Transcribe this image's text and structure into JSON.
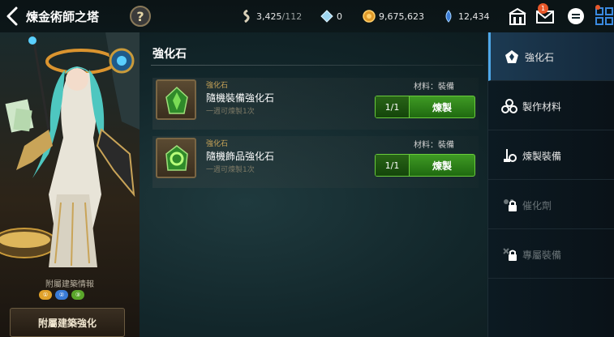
{
  "header": {
    "title": "煉金術師之塔",
    "help_label": "?",
    "resources": {
      "stamina": {
        "value": "3,425",
        "max": "/112",
        "icon": "stamina-icon"
      },
      "crystal": {
        "value": "0",
        "icon": "crystal-icon"
      },
      "gold": {
        "value": "9,675,623",
        "icon": "gold-coin-icon"
      },
      "gem": {
        "value": "12,434",
        "icon": "gem-icon"
      }
    },
    "mail_badge": "1",
    "icons": [
      "guild-icon",
      "mail-icon",
      "chat-icon",
      "menu-grid-icon"
    ]
  },
  "left_panel": {
    "building_info_label": "附屬建築情報",
    "dots": [
      "①",
      "②",
      "③"
    ],
    "enhance_button": "附屬建築強化"
  },
  "main": {
    "section_title": "強化石",
    "recipes": [
      {
        "category": "強化石",
        "name": "隨機裝備強化石",
        "limit": "一週可煉製1次",
        "material": "材料：裝備",
        "count": "1/1",
        "craft_label": "煉製"
      },
      {
        "category": "強化石",
        "name": "隨機飾品強化石",
        "limit": "一週可煉製1次",
        "material": "材料：裝備",
        "count": "1/1",
        "craft_label": "煉製"
      }
    ]
  },
  "tabs": [
    {
      "label": "強化石",
      "icon": "enhance-stone-icon",
      "active": true,
      "locked": false
    },
    {
      "label": "製作材料",
      "icon": "materials-icon",
      "active": false,
      "locked": false
    },
    {
      "label": "煉製裝備",
      "icon": "craft-equipment-icon",
      "active": false,
      "locked": false
    },
    {
      "label": "催化劑",
      "icon": "catalyst-icon",
      "active": false,
      "locked": true
    },
    {
      "label": "專屬裝備",
      "icon": "exclusive-equipment-icon",
      "active": false,
      "locked": true
    }
  ],
  "colors": {
    "craft_green": "#3f9a24",
    "active_tab": "#1c3a52",
    "category_gold": "#c9a458",
    "badge_orange": "#e8582a"
  }
}
